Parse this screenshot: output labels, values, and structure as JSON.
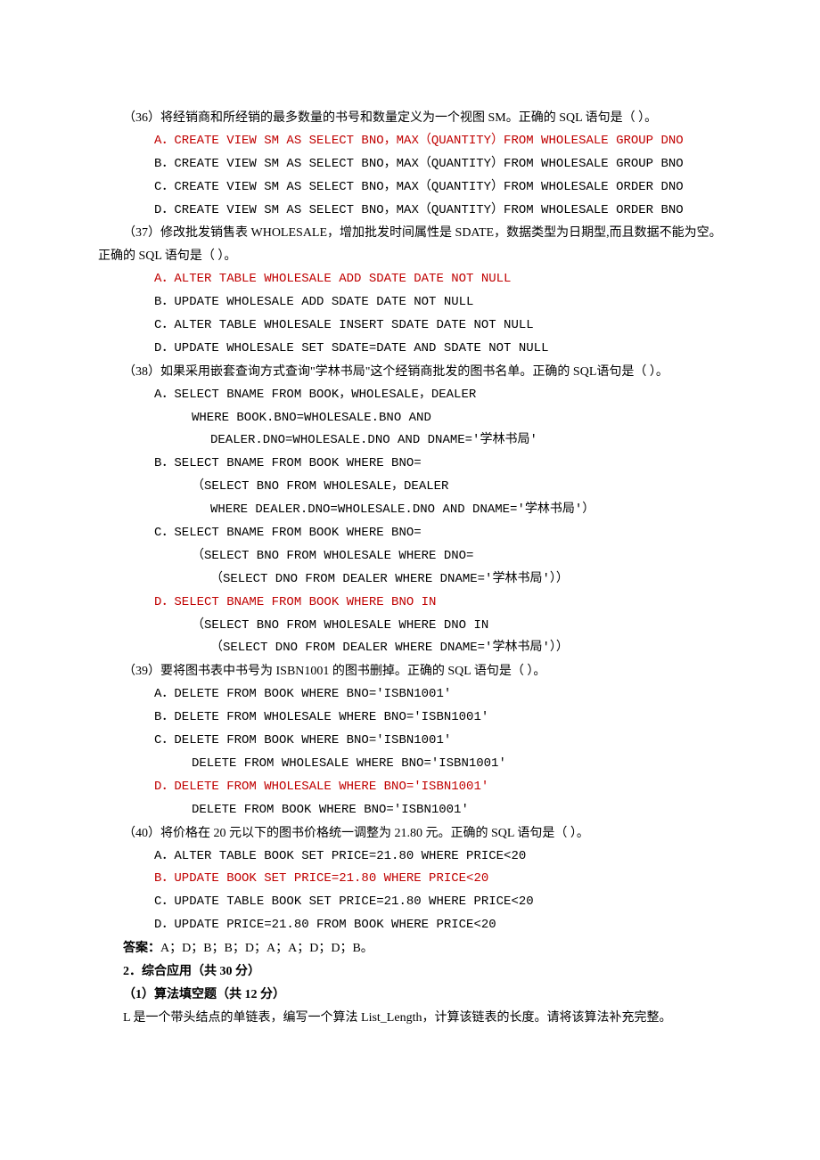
{
  "q36": {
    "stem": "（36）将经销商和所经销的最多数量的书号和数量定义为一个视图 SM。正确的 SQL 语句是（  ）。",
    "A": "A．CREATE VIEW SM AS SELECT BNO，MAX（QUANTITY）FROM WHOLESALE GROUP DNO",
    "B": "B．CREATE VIEW SM AS SELECT BNO，MAX（QUANTITY）FROM WHOLESALE GROUP BNO",
    "C": "C．CREATE VIEW SM AS SELECT BNO，MAX（QUANTITY）FROM WHOLESALE ORDER DNO",
    "D": "D．CREATE VIEW SM AS SELECT BNO，MAX（QUANTITY）FROM WHOLESALE ORDER BNO"
  },
  "q37": {
    "stem": "（37）修改批发销售表 WHOLESALE，增加批发时间属性是 SDATE，数据类型为日期型,而且数据不能为空。正确的 SQL 语句是（  ）。",
    "A": "A．ALTER TABLE WHOLESALE ADD SDATE DATE NOT NULL",
    "B": "B．UPDATE WHOLESALE ADD SDATE DATE NOT NULL",
    "C": "C．ALTER TABLE WHOLESALE INSERT SDATE DATE NOT NULL",
    "D": "D．UPDATE WHOLESALE SET SDATE=DATE AND SDATE NOT NULL"
  },
  "q38": {
    "stem": "（38）如果采用嵌套查询方式查询\"学林书局\"这个经销商批发的图书名单。正确的 SQL语句是（  ）。",
    "A": "A．SELECT BNAME FROM BOOK，WHOLESALE，DEALER",
    "A1": "WHERE BOOK.BNO=WHOLESALE.BNO AND",
    "A2": "DEALER.DNO=WHOLESALE.DNO AND DNAME='学林书局'",
    "B": "B．SELECT BNAME FROM BOOK WHERE BNO=",
    "B1": "（SELECT BNO FROM WHOLESALE，DEALER",
    "B2": "WHERE DEALER.DNO=WHOLESALE.DNO AND DNAME='学林书局'）",
    "C": "C．SELECT BNAME FROM BOOK WHERE BNO=",
    "C1": "（SELECT BNO FROM WHOLESALE WHERE DNO=",
    "C2": "（SELECT DNO FROM DEALER WHERE DNAME='学林书局'））",
    "D": "D．SELECT BNAME FROM BOOK WHERE BNO IN",
    "D1": "（SELECT BNO FROM WHOLESALE WHERE DNO IN",
    "D2": "（SELECT DNO FROM DEALER WHERE DNAME='学林书局'））"
  },
  "q39": {
    "stem": "（39）要将图书表中书号为 ISBN1001 的图书删掉。正确的 SQL 语句是（  ）。",
    "A": "A．DELETE FROM BOOK WHERE BNO='ISBN1001'",
    "B": "B．DELETE FROM WHOLESALE WHERE BNO='ISBN1001'",
    "C": "C．DELETE FROM BOOK WHERE BNO='ISBN1001'",
    "C1": "DELETE FROM WHOLESALE WHERE BNO='ISBN1001'",
    "D": "D．DELETE FROM WHOLESALE WHERE BNO='ISBN1001'",
    "D1": "DELETE FROM BOOK WHERE BNO='ISBN1001'"
  },
  "q40": {
    "stem": "（40）将价格在 20 元以下的图书价格统一调整为 21.80 元。正确的 SQL 语句是（  ）。",
    "A": "A．ALTER TABLE BOOK SET PRICE=21.80 WHERE PRICE<20",
    "B": "B．UPDATE BOOK SET PRICE=21.80 WHERE PRICE<20",
    "C": "C．UPDATE TABLE BOOK SET PRICE=21.80 WHERE PRICE<20",
    "D": "D．UPDATE PRICE=21.80 FROM BOOK WHERE PRICE<20"
  },
  "answers": {
    "label": "答案：",
    "text": "A；D；B；B；D；A；A；D；D；B。"
  },
  "section2": {
    "title": "2．综合应用（共 30 分）",
    "sub1": "（1）算法填空题（共 12 分）",
    "p1": "L 是一个带头结点的单链表，编写一个算法 List_Length，计算该链表的长度。请将该算法补充完整。"
  }
}
